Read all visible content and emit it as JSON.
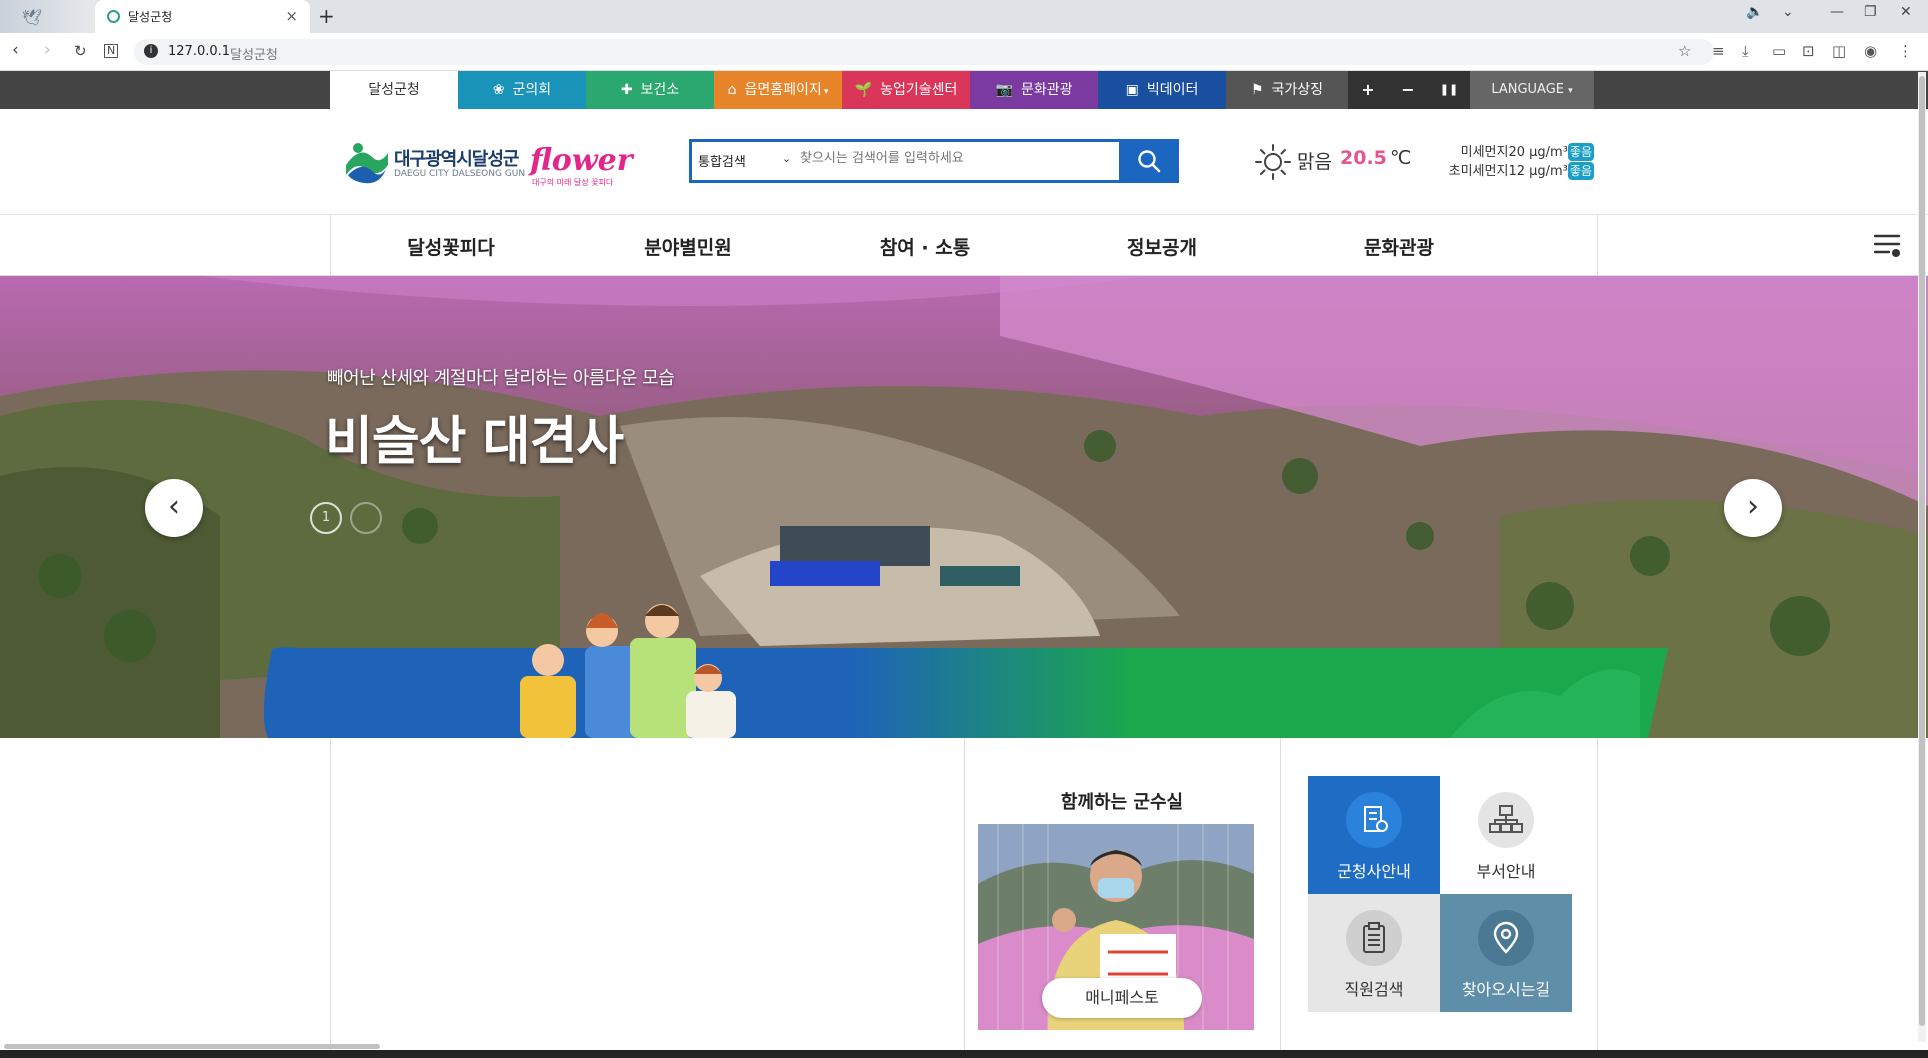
{
  "browser": {
    "tab_title": "달성군청",
    "url_host": "127.0.0.1",
    "url_title": "달성군청"
  },
  "sitebar": {
    "items": [
      {
        "label": "달성군청",
        "color": "#ffffff",
        "icon": "home-tab"
      },
      {
        "label": "군의회",
        "color": "#1a93b8",
        "icon": "council-icon"
      },
      {
        "label": "보건소",
        "color": "#2ba86f",
        "icon": "health-icon"
      },
      {
        "label": "읍면홈페이지",
        "color": "#e8842a",
        "icon": "house-icon"
      },
      {
        "label": "농업기술센터",
        "color": "#d9365a",
        "icon": "sprout-icon"
      },
      {
        "label": "문화관광",
        "color": "#7b3aa0",
        "icon": "camera-icon"
      },
      {
        "label": "빅데이터",
        "color": "#1a4fa0",
        "icon": "monitor-icon"
      },
      {
        "label": "국가상징",
        "color": "#555555",
        "icon": "flag-icon"
      }
    ],
    "zoom_in": "+",
    "zoom_out": "−",
    "pause": "❚❚",
    "language": "LANGUAGE"
  },
  "header": {
    "logo_korean": "대구광역시달성군",
    "logo_english": "DAEGU CITY DALSEONG GUN",
    "logo_flower": "flower",
    "logo_sub": "대구의 미래 달성 꽃피다",
    "search_scope": "통합검색",
    "search_placeholder": "찾으시는 검색어를 입력하세요",
    "weather_desc": "맑음",
    "weather_temp": "20.5",
    "weather_unit": "℃",
    "pm10": "미세먼지20 μg/m³",
    "pm10_status": "좋음",
    "pm25": "초미세먼지12 μg/m³",
    "pm25_status": "좋음"
  },
  "gnb": {
    "menus": [
      "달성꽃피다",
      "분야별민원",
      "참여 · 소통",
      "정보공개",
      "문화관광"
    ]
  },
  "hero": {
    "subtitle": "빼어난 산세와 계절마다 달리하는 아름다운 모습",
    "title": "비슬산 대견사",
    "page": "1"
  },
  "mayor": {
    "heading": "함께하는 군수실",
    "manifesto": "매니페스토"
  },
  "quick_links": [
    {
      "label": "군청사안내",
      "icon": "building-icon"
    },
    {
      "label": "부서안내",
      "icon": "org-chart-icon"
    },
    {
      "label": "직원검색",
      "icon": "clipboard-icon"
    },
    {
      "label": "찾아오시는길",
      "icon": "location-pin-icon"
    }
  ]
}
